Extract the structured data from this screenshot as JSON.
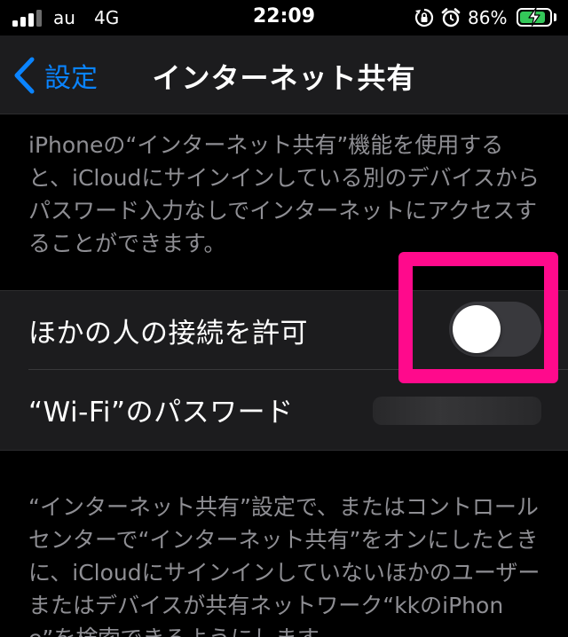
{
  "status_bar": {
    "carrier": "au",
    "network": "4G",
    "time": "22:09",
    "battery_percent": "86%",
    "battery_level": 0.86,
    "signal_bars_active": 3,
    "signal_bars_total": 4,
    "icons": [
      "signal-icon",
      "rotation-lock-icon",
      "alarm-icon",
      "battery-charging-icon"
    ]
  },
  "nav": {
    "back_label": "設定",
    "title": "インターネット共有"
  },
  "description_top": "iPhoneの“インターネット共有”機能を使用すると、iCloudにサインインしている別のデバイスからパスワード入力なしでインターネットにアクセスすることができます。",
  "settings": {
    "allow_others": {
      "label": "ほかの人の接続を許可",
      "enabled": false
    },
    "wifi_password": {
      "label": "“Wi-Fi”のパスワード"
    }
  },
  "description_bottom": "“インターネット共有”設定で、またはコントロールセンターで“インターネット共有”をオンにしたときに、iCloudにサインインしていないほかのユーザーまたはデバイスが共有ネットワーク“kkのiPhone”を検索できるようにします。",
  "colors": {
    "accent": "#0a84ff",
    "highlight": "#ff0a8c",
    "battery_charging": "#34c759",
    "background": "#000000",
    "cell_background": "#1c1c1e",
    "secondary_text": "#8e8e93",
    "toggle_off": "#39393d"
  }
}
